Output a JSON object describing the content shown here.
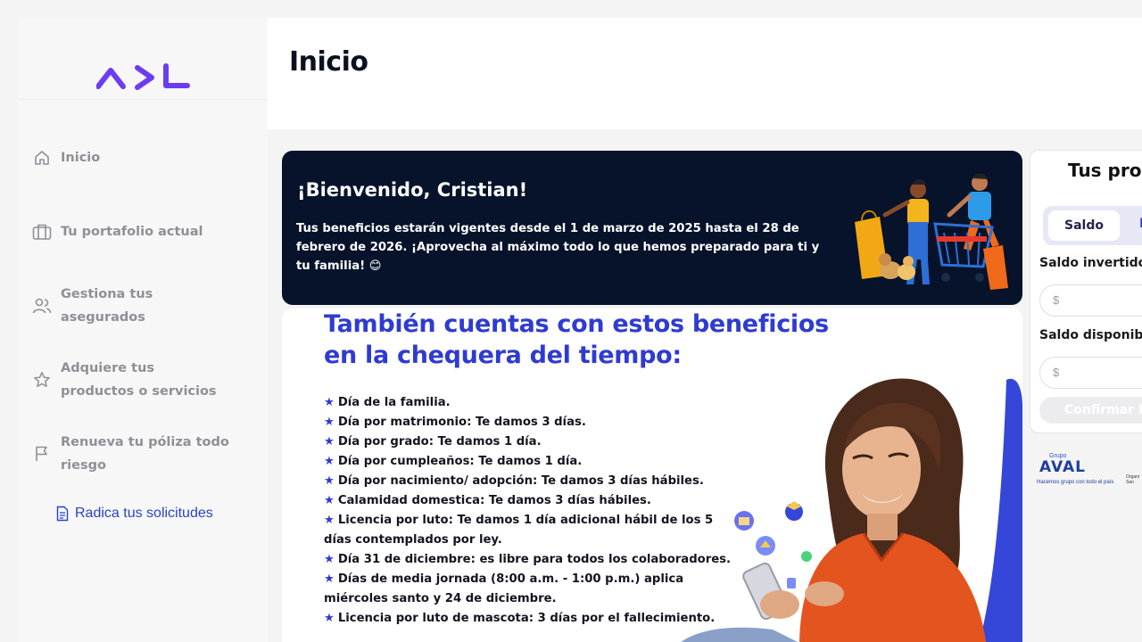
{
  "brand": {
    "logo_text": "AVL",
    "accent": "#6c3cf0"
  },
  "sidebar": {
    "items": [
      {
        "label": "Inicio",
        "icon": "home-icon"
      },
      {
        "label": "Tu portafolio actual",
        "icon": "briefcase-icon"
      },
      {
        "label": "Gestiona tus asegurados",
        "icon": "users-icon"
      },
      {
        "label": "Adquiere tus productos o servicios",
        "icon": "star-icon"
      },
      {
        "label": "Renueva tu póliza todo riesgo",
        "icon": "flag-icon"
      },
      {
        "label": "Radica tus solicitudes",
        "icon": "document-icon"
      }
    ]
  },
  "header": {
    "title": "Inicio"
  },
  "welcome": {
    "title": "¡Bienvenido, Cristian!",
    "message": "Tus beneficios estarán vigentes desde el 1 de marzo de 2025 hasta el 28 de febrero de 2026. ¡Aprovecha al máximo todo lo que hemos preparado para ti y tu familia! 😊",
    "background": "#06132b"
  },
  "banner": {
    "title": "También cuentas con estos beneficios en la chequera del tiempo:",
    "items": [
      "Día de la familia.",
      "Día por matrimonio: Te damos 3 días.",
      "Día por grado: Te damos 1 día.",
      "Día por cumpleaños: Te damos 1 día.",
      "Día por nacimiento/ adopción: Te damos 3 días hábiles.",
      "Calamidad domestica: Te damos 3 días hábiles.",
      "Licencia por luto: Te damos 1 día adicional hábil de los 5 días contemplados por ley.",
      "Día 31 de diciembre: es libre para todos los colaboradores.",
      "Días de media jornada (8:00 a.m. - 1:00 p.m.) aplica miércoles santo y 24 de diciembre.",
      "Licencia por luto de mascota: 3 días por el fallecimiento."
    ],
    "title_color": "#2f3bd0"
  },
  "products": {
    "title": "Tus proc",
    "tab_active": "Saldo",
    "tab_other": "F",
    "invested_label": "Saldo invertido",
    "invested_placeholder": "$",
    "available_label": "Saldo disponible",
    "available_placeholder": "$",
    "confirm_label": "Confirmar b"
  },
  "footer_logo": {
    "group": "Grupo",
    "name": "AVAL",
    "tagline": "Hacemos grupo con todo el país",
    "right_text": "Organi San"
  }
}
